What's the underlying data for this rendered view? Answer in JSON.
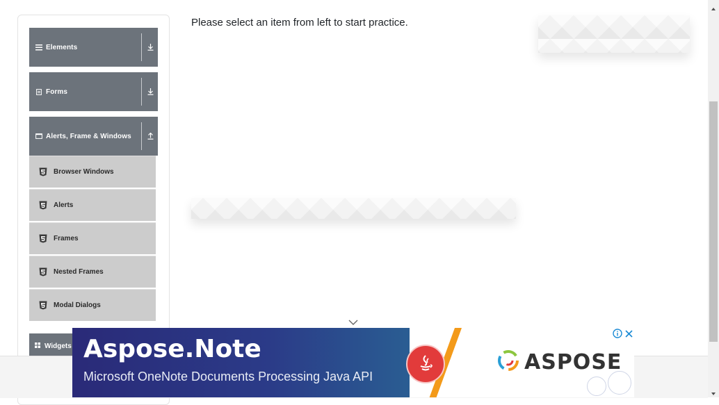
{
  "main": {
    "prompt": "Please select an item from left to start practice."
  },
  "sidebar": {
    "groups": [
      {
        "label": "Elements",
        "icon": "hamburger-icon",
        "toggle": "download-arrow-icon"
      },
      {
        "label": "Forms",
        "icon": "document-icon",
        "toggle": "download-arrow-icon"
      },
      {
        "label": "Alerts, Frame & Windows",
        "icon": "window-icon",
        "toggle": "upload-arrow-icon"
      },
      {
        "label": "Widgets",
        "icon": "grid-icon"
      }
    ],
    "items": [
      {
        "label": "Browser Windows"
      },
      {
        "label": "Alerts"
      },
      {
        "label": "Frames"
      },
      {
        "label": "Nested Frames"
      },
      {
        "label": "Modal Dialogs"
      }
    ]
  },
  "ad": {
    "title": "Aspose.Note",
    "subtitle": "Microsoft OneNote Documents Processing  Java API",
    "logo_text": "ASPOSE",
    "info_label": "i",
    "close_label": "×"
  },
  "colors": {
    "group_header_bg": "#6c737b",
    "sub_item_bg": "#cccccc",
    "ad_blue": "#2a2a78",
    "ad_orange": "#f39a1a"
  }
}
